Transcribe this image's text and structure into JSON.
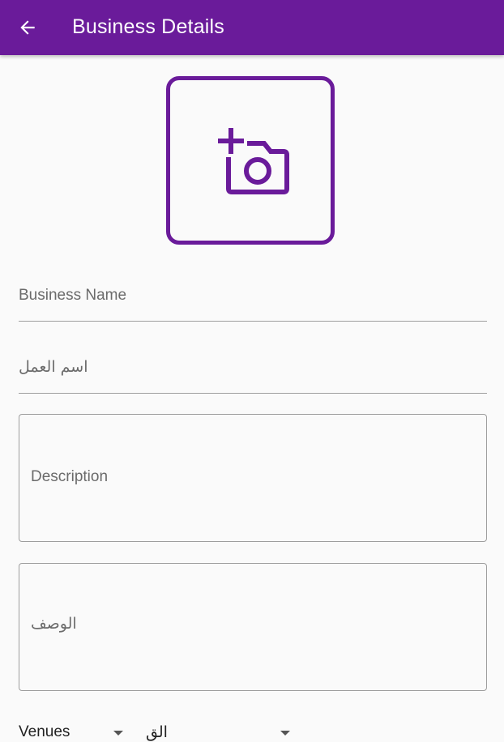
{
  "app_bar": {
    "title": "Business Details",
    "back_icon": "arrow-back-icon",
    "color": "#6a1b9a"
  },
  "image_picker": {
    "icon": "add-photo-icon"
  },
  "form": {
    "business_name_label": "Business Name",
    "business_name_ar_label": "اسم العمل",
    "description_label": "Description",
    "description_ar_label": "الوصف"
  },
  "dropdowns": [
    {
      "value": "Venues"
    },
    {
      "value": "الق"
    }
  ]
}
